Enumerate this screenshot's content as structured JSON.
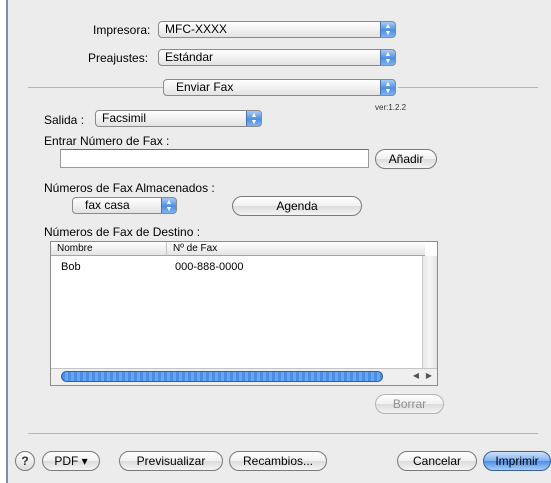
{
  "printer": {
    "label": "Impresora:",
    "value": "MFC-XXXX"
  },
  "presets": {
    "label": "Preajustes:",
    "value": "Estándar"
  },
  "panel": {
    "value": "Enviar Fax"
  },
  "version": "ver:1.2.2",
  "output": {
    "label": "Salida :",
    "value": "Facsimil"
  },
  "fax_number": {
    "label": "Entrar Número de Fax :",
    "value": "",
    "add_button": "Añadir"
  },
  "stored": {
    "label": "Números de Fax Almacenados :",
    "value": "fax casa",
    "agenda_button": "Agenda"
  },
  "destination": {
    "label": "Números de Fax de Destino :",
    "columns": [
      "Nombre",
      "Nº de Fax"
    ],
    "rows": [
      {
        "name": "Bob",
        "fax": "000-888-0000"
      }
    ],
    "delete_button": "Borrar"
  },
  "footer": {
    "help": "?",
    "pdf": "PDF ▾",
    "preview": "Previsualizar",
    "supplies": "Recambios...",
    "cancel": "Cancelar",
    "print": "Imprimir"
  },
  "colors": {
    "accent": "#4d8ee3",
    "panel_bg": "#ececec"
  }
}
